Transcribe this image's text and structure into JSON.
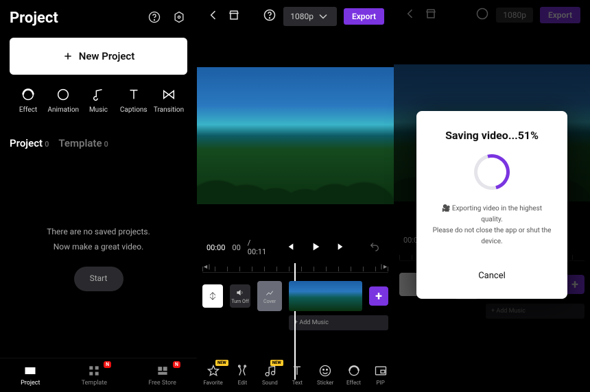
{
  "colors": {
    "accent": "#7a34e0"
  },
  "pane1": {
    "title": "Project",
    "new_project": "New Project",
    "tools": [
      {
        "id": "effect",
        "label": "Effect"
      },
      {
        "id": "animation",
        "label": "Animation"
      },
      {
        "id": "music",
        "label": "Music"
      },
      {
        "id": "captions",
        "label": "Captions"
      },
      {
        "id": "transition",
        "label": "Transition"
      }
    ],
    "tabs": {
      "project": {
        "label": "Project",
        "count": 0
      },
      "template": {
        "label": "Template",
        "count": 0
      }
    },
    "empty1": "There are no saved projects.",
    "empty2": "Now make a great video.",
    "start": "Start",
    "nav": [
      {
        "id": "project",
        "label": "Project",
        "badge": null
      },
      {
        "id": "template",
        "label": "Template",
        "badge": "N"
      },
      {
        "id": "freestore",
        "label": "Free Store",
        "badge": "N"
      }
    ]
  },
  "pane2": {
    "resolution": "1080p",
    "export": "Export",
    "time_current": "00:00",
    "time_fractional": "00",
    "time_total": "/ 00:11",
    "track": {
      "turnoff": "Turn Off",
      "cover": "Cover",
      "add_music": "+  Add Music"
    },
    "tools": [
      {
        "id": "favorite",
        "label": "Favorite",
        "badge": "NEW"
      },
      {
        "id": "edit",
        "label": "Edit",
        "badge": null
      },
      {
        "id": "sound",
        "label": "Sound",
        "badge": "NEW"
      },
      {
        "id": "text",
        "label": "Text",
        "badge": null
      },
      {
        "id": "sticker",
        "label": "Sticker",
        "badge": null
      },
      {
        "id": "effect",
        "label": "Effect",
        "badge": null
      },
      {
        "id": "pip",
        "label": "PIP",
        "badge": null
      }
    ]
  },
  "pane3": {
    "modal_title": "Saving video...51%",
    "modal_desc_icon": "🎥",
    "modal_desc1": "Exporting video in the highest quality.",
    "modal_desc2": "Please do not close the app or shut the device.",
    "cancel": "Cancel"
  }
}
